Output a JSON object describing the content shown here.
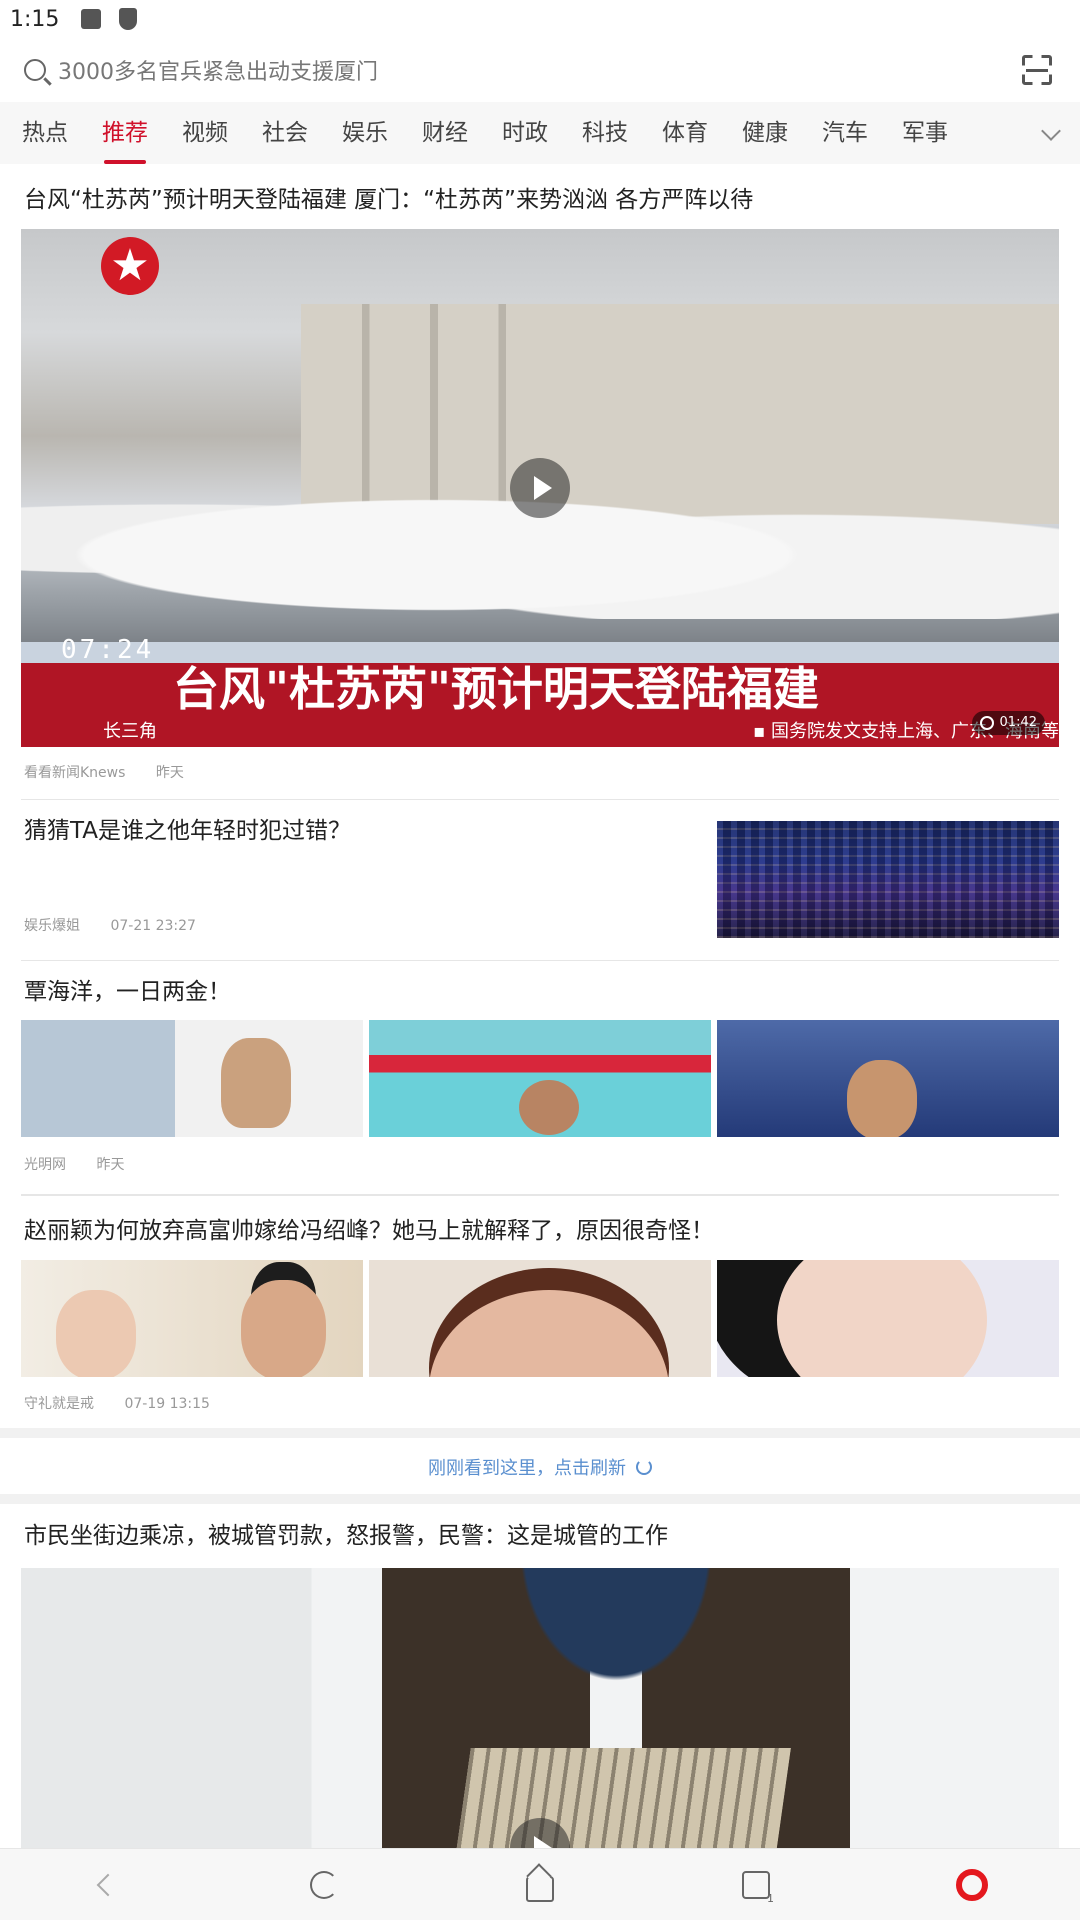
{
  "status_bar": {
    "time": "1:15"
  },
  "search": {
    "placeholder": "3000多名官兵紧急出动支援厦门"
  },
  "tabs": [
    {
      "label": "热点"
    },
    {
      "label": "推荐"
    },
    {
      "label": "视频"
    },
    {
      "label": "社会"
    },
    {
      "label": "娱乐"
    },
    {
      "label": "财经"
    },
    {
      "label": "时政"
    },
    {
      "label": "科技"
    },
    {
      "label": "体育"
    },
    {
      "label": "健康"
    },
    {
      "label": "汽车"
    },
    {
      "label": "军事"
    }
  ],
  "active_tab": "推荐",
  "colors": {
    "accent": "#d0112b",
    "refresh": "#5a8fcf"
  },
  "feed": [
    {
      "title": "台风“杜苏芮”预计明天登陆福建 厦门：“杜苏芮”来势汹汹 各方严阵以待",
      "source": "看看新闻Knews",
      "time": "昨天",
      "video_duration": "01:42",
      "video_overlay": {
        "clock": "07:24",
        "banner": "台风\"杜苏芮\"预计明天登陆福建",
        "region": "长三角",
        "ticker": "▪ 国务院发文支持上海、广东、海南等"
      }
    },
    {
      "title": "猜猜TA是谁之他年轻时犯过错？",
      "source": "娱乐爆姐",
      "time": "07-21 23:27"
    },
    {
      "title": "覃海洋，一日两金！",
      "source": "光明网",
      "time": "昨天"
    },
    {
      "title": "赵丽颖为何放弃高富帅嫁给冯绍峰？她马上就解释了，原因很奇怪！",
      "source": "守礼就是戒",
      "time": "07-19 13:15"
    },
    {
      "title": "市民坐街边乘凉，被城管罚款，怒报警，民警：这是城管的工作"
    }
  ],
  "refresh_text": "刚刚看到这里，点击刷新",
  "bottom_nav": [
    "back-icon",
    "reload-icon",
    "home-icon",
    "tabs-icon",
    "opera-icon"
  ]
}
